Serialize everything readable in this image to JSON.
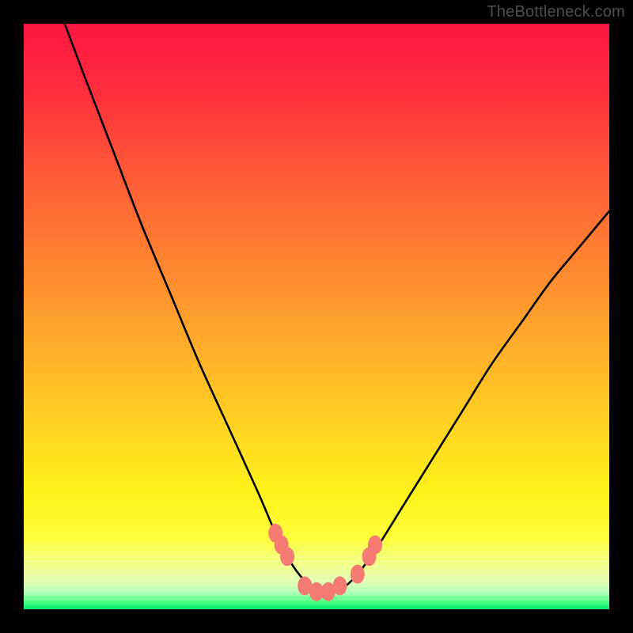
{
  "watermark": "TheBottleneck.com",
  "colors": {
    "frame": "#000000",
    "curve": "#000000",
    "marker_fill": "#f47a72",
    "marker_stroke": "#f47a72",
    "gradient_top": "#ff163f",
    "gradient_bottom": "#00e66a"
  },
  "chart_data": {
    "type": "line",
    "title": "",
    "xlabel": "",
    "ylabel": "",
    "xlim": [
      0,
      100
    ],
    "ylim": [
      0,
      100
    ],
    "grid": false,
    "legend": false,
    "series": [
      {
        "name": "bottleneck-curve",
        "x": [
          7,
          10,
          15,
          20,
          25,
          30,
          35,
          40,
          43,
          45,
          47,
          49,
          51,
          53,
          55,
          57,
          60,
          65,
          70,
          75,
          80,
          85,
          90,
          95,
          100
        ],
        "y": [
          100,
          92,
          79,
          66,
          54,
          42,
          31,
          20,
          13,
          9,
          6,
          4,
          3,
          3,
          4,
          6,
          10,
          18,
          26,
          34,
          42,
          49,
          56,
          62,
          68
        ]
      }
    ],
    "markers": [
      {
        "x": 43,
        "y": 13
      },
      {
        "x": 44,
        "y": 11
      },
      {
        "x": 45,
        "y": 9
      },
      {
        "x": 48,
        "y": 4
      },
      {
        "x": 50,
        "y": 3
      },
      {
        "x": 52,
        "y": 3
      },
      {
        "x": 54,
        "y": 4
      },
      {
        "x": 57,
        "y": 6
      },
      {
        "x": 59,
        "y": 9
      },
      {
        "x": 60,
        "y": 11
      }
    ]
  }
}
